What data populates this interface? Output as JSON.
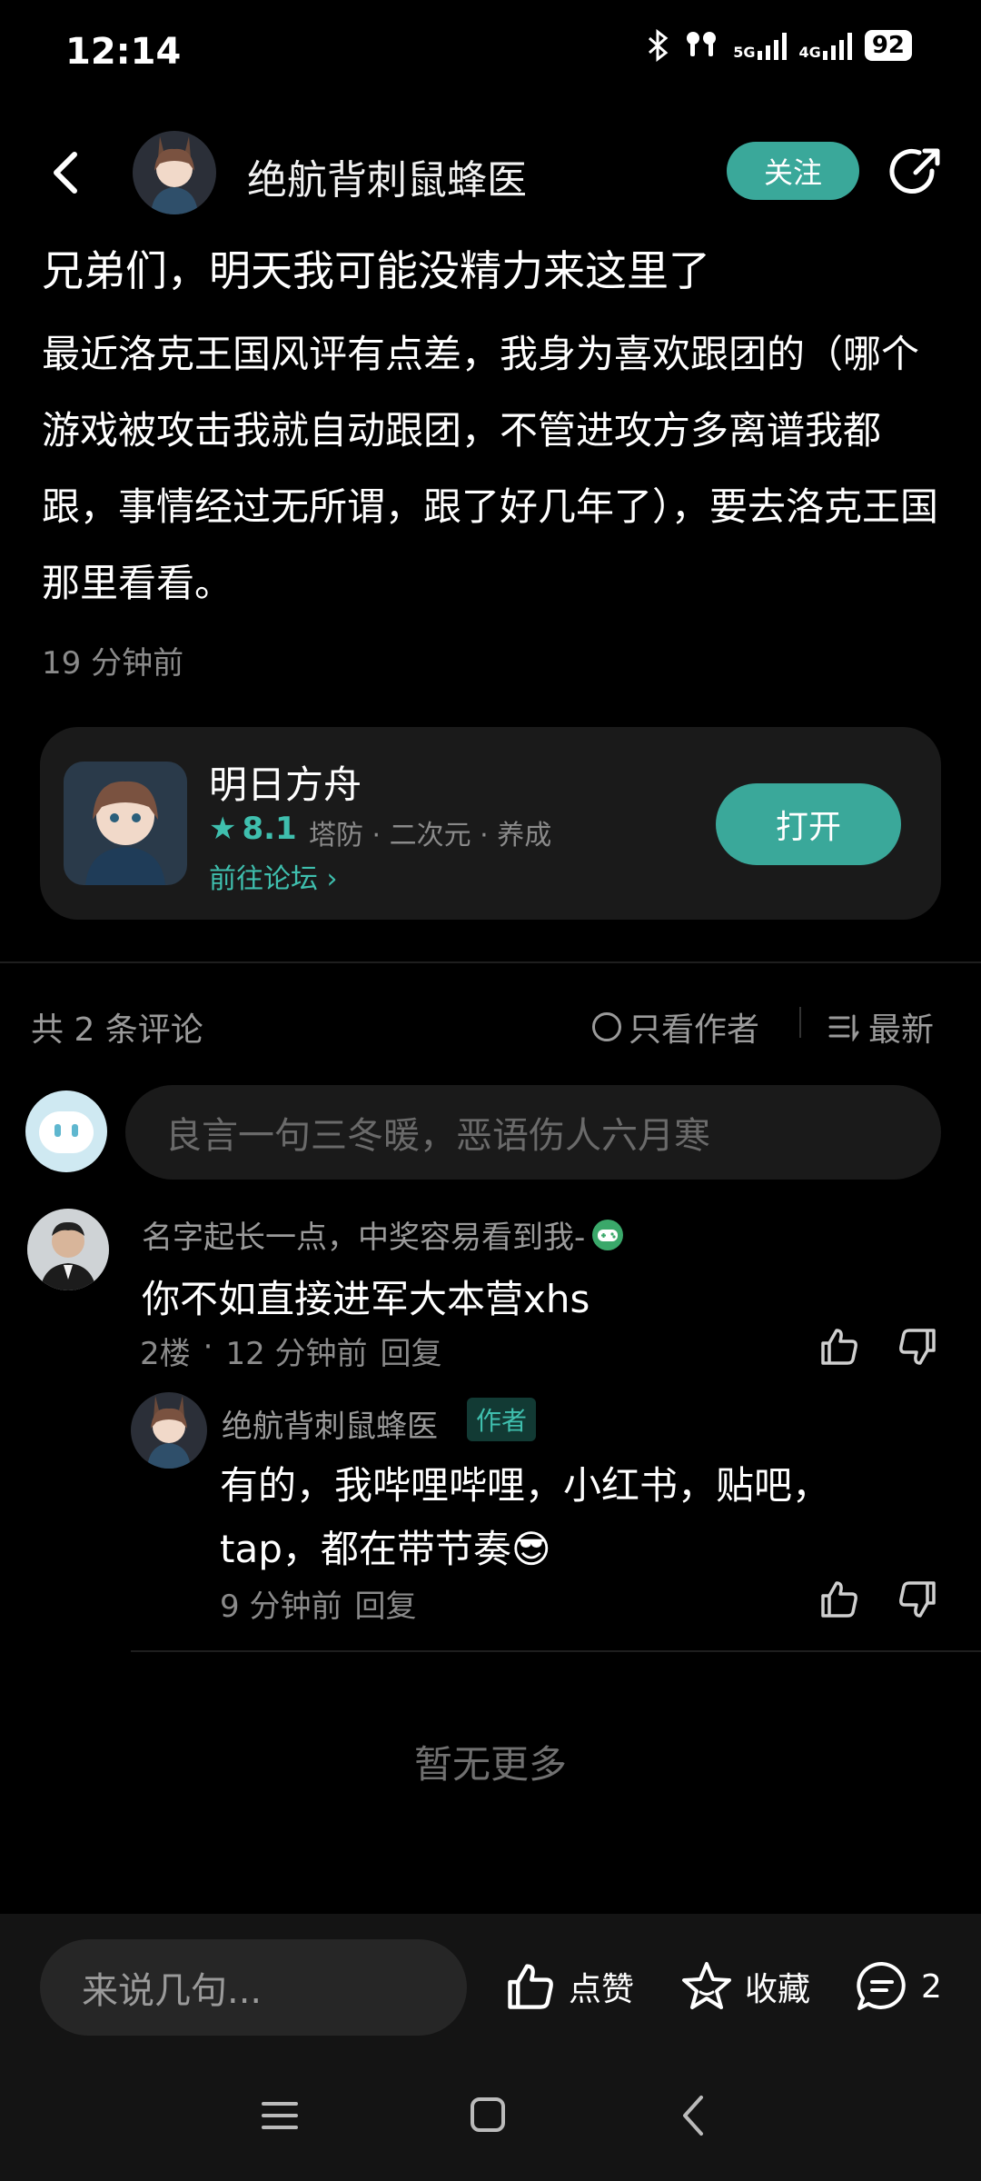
{
  "status_bar": {
    "time": "12:14",
    "net_5g": "5G",
    "net_4g": "4G",
    "battery": "92"
  },
  "header": {
    "author_name": "绝航背刺鼠蜂医",
    "follow_label": "关注"
  },
  "post": {
    "title": "兄弟们，明天我可能没精力来这里了",
    "body": "最近洛克王国风评有点差，我身为喜欢跟团的（哪个游戏被攻击我就自动跟团，不管进攻方多离谱我都跟，事情经过无所谓，跟了好几年了），要去洛克王国那里看看。",
    "time": "19 分钟前"
  },
  "game_card": {
    "name": "明日方舟",
    "rating": "8.1",
    "tags": "塔防 · 二次元 · 养成",
    "forum_link": "前往论坛 ›",
    "open_label": "打开"
  },
  "comments_header": {
    "count": "共 2 条评论",
    "only_author": "只看作者",
    "sort": "最新"
  },
  "comment_input": {
    "placeholder": "良言一句三冬暖，恶语伤人六月寒"
  },
  "comments": [
    {
      "name": "名字起长一点，中奖容易看到我-",
      "text": "你不如直接进军大本营xhs",
      "floor": "2楼",
      "time": "12 分钟前",
      "reply_label": "回复",
      "replies": [
        {
          "name": "绝航背刺鼠蜂医",
          "badge": "作者",
          "text": "有的，我哔哩哔哩，小红书，贴吧，tap，都在带节奏😎",
          "time": "9 分钟前",
          "reply_label": "回复"
        }
      ]
    }
  ],
  "no_more": "暂无更多",
  "bottom_bar": {
    "input_placeholder": "来说几句...",
    "like_label": "点赞",
    "fav_label": "收藏",
    "comment_count": "2"
  },
  "colors": {
    "accent": "#3aa89a",
    "accent_text": "#3fbfae",
    "background": "#000000",
    "card": "#1a1a1a"
  }
}
